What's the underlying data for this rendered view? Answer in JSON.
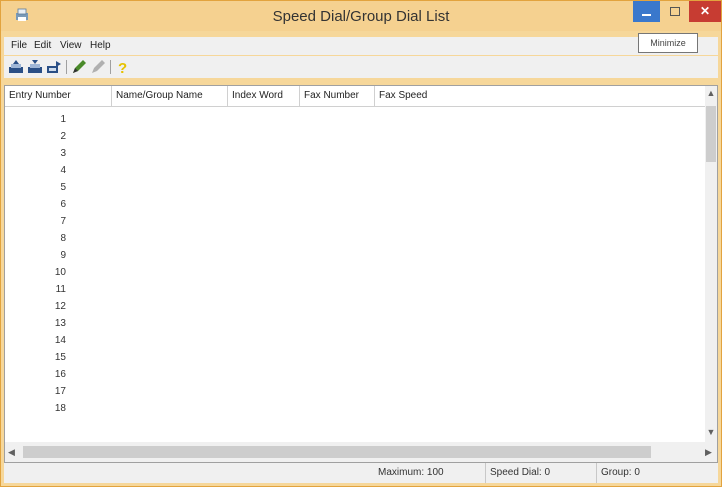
{
  "window": {
    "title": "Speed Dial/Group Dial List",
    "icon": "printer-fax-app-icon",
    "tooltip": "Minimize",
    "colors": {
      "frame": "#f6d79a",
      "minimize": "#3a78cc",
      "close": "#c73c32"
    }
  },
  "menu": [
    "File",
    "Edit",
    "View",
    "Help"
  ],
  "toolbar": [
    {
      "icon": "printer-upload-icon"
    },
    {
      "icon": "printer-download-icon"
    },
    {
      "icon": "export-icon"
    },
    {
      "icon": "pencil-edit-icon"
    },
    {
      "icon": "pencil-disabled-icon"
    },
    {
      "icon": "help-question-icon"
    }
  ],
  "columns": [
    "Entry Number",
    "Name/Group Name",
    "Index Word",
    "Fax Number",
    "Fax Speed"
  ],
  "rows": [
    "1",
    "2",
    "3",
    "4",
    "5",
    "6",
    "7",
    "8",
    "9",
    "10",
    "11",
    "12",
    "13",
    "14",
    "15",
    "16",
    "17",
    "18"
  ],
  "status": {
    "maximum": "Maximum: 100",
    "speed_dial": "Speed Dial: 0",
    "group": "Group: 0"
  }
}
